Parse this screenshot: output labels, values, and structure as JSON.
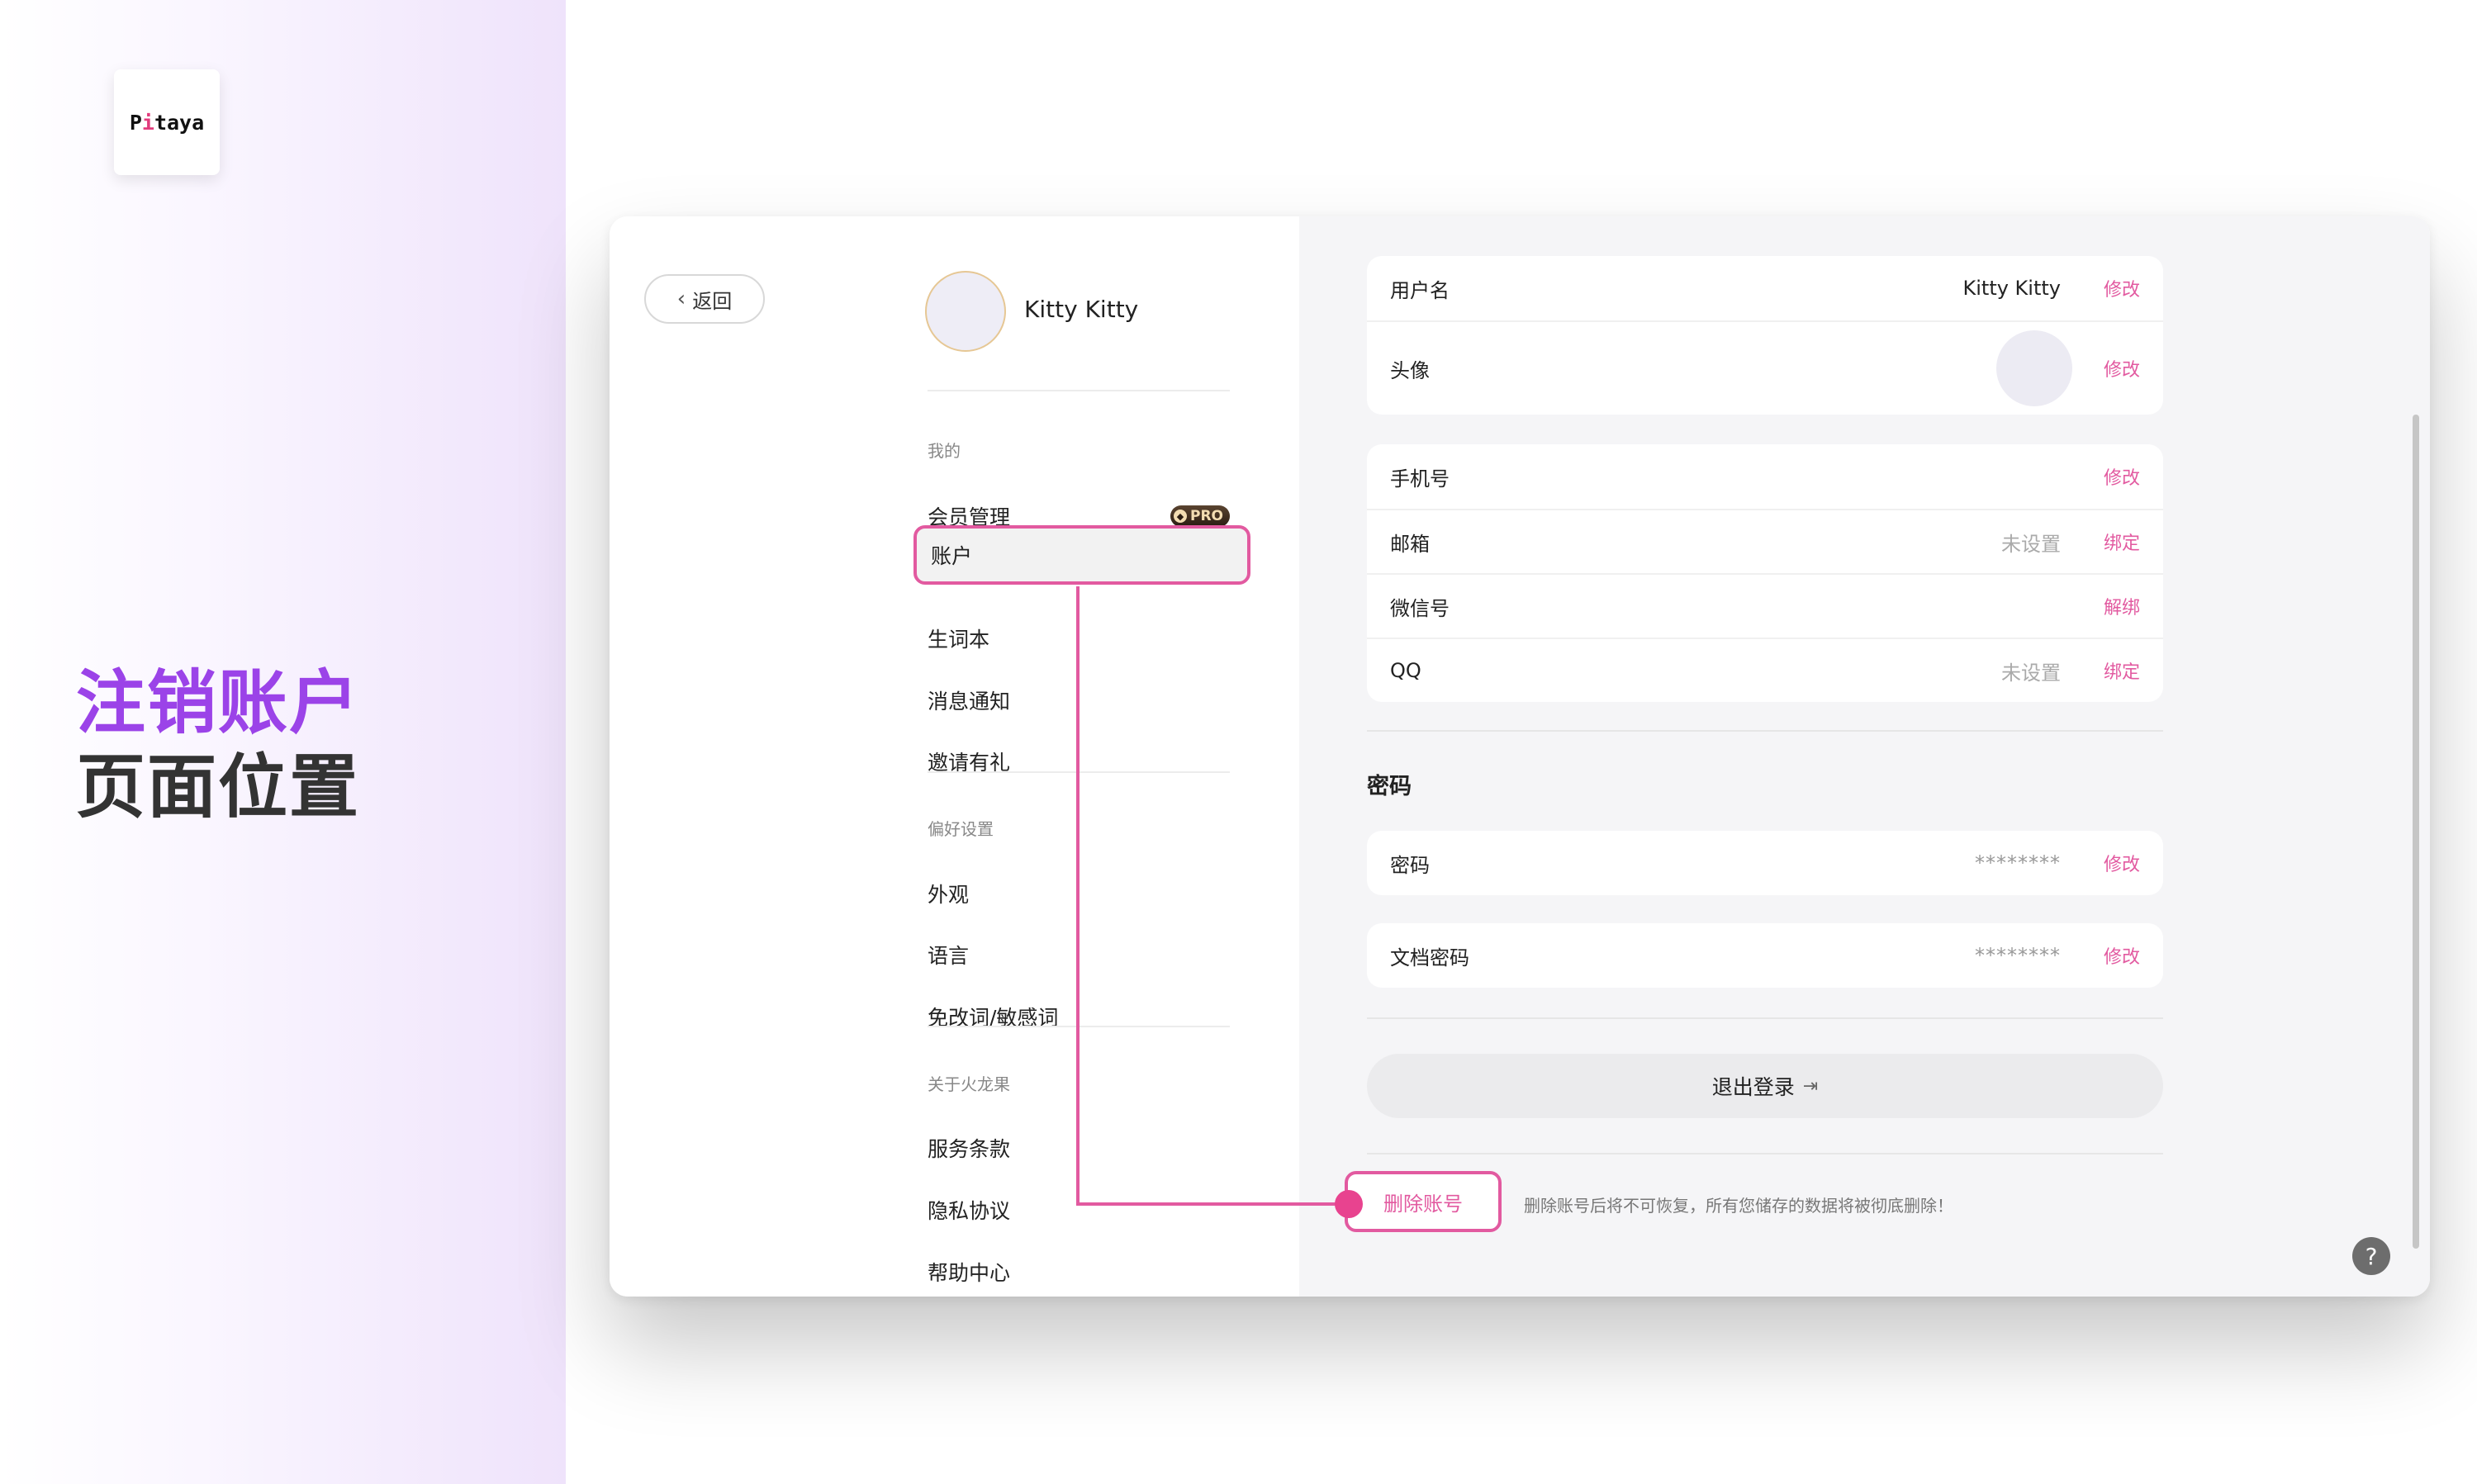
{
  "brand": {
    "logo_text_pre": "P",
    "logo_text_i": "i",
    "logo_text_post": "taya"
  },
  "headline": {
    "line1": "注销账户",
    "line2": "页面位置"
  },
  "sidebar": {
    "back_label": "返回",
    "user_name": "Kitty Kitty",
    "section_mine": "我的",
    "items_mine": [
      {
        "label": "会员管理",
        "badge": "PRO"
      },
      {
        "label": "账户"
      },
      {
        "label": "生词本"
      },
      {
        "label": "消息通知"
      },
      {
        "label": "邀请有礼"
      }
    ],
    "section_pref": "偏好设置",
    "items_pref": [
      {
        "label": "外观"
      },
      {
        "label": "语言"
      },
      {
        "label": "免改词/敏感词"
      }
    ],
    "section_about": "关于火龙果",
    "items_about": [
      {
        "label": "服务条款"
      },
      {
        "label": "隐私协议"
      },
      {
        "label": "帮助中心"
      }
    ]
  },
  "account": {
    "profile_rows": [
      {
        "label": "用户名",
        "value": "Kitty Kitty",
        "action": "修改"
      },
      {
        "label": "头像",
        "action": "修改"
      }
    ],
    "contact_rows": [
      {
        "label": "手机号",
        "value": "",
        "action": "修改"
      },
      {
        "label": "邮箱",
        "value": "未设置",
        "action": "绑定"
      },
      {
        "label": "微信号",
        "value": "",
        "action": "解绑"
      },
      {
        "label": "QQ",
        "value": "未设置",
        "action": "绑定"
      }
    ],
    "password_title": "密码",
    "password_rows": [
      {
        "label": "密码",
        "value": "********",
        "action": "修改"
      },
      {
        "label": "文档密码",
        "value": "********",
        "action": "修改"
      }
    ],
    "logout_label": "退出登录",
    "delete_label": "删除账号",
    "delete_note": "删除账号后将不可恢复，所有您储存的数据将被彻底删除！",
    "help_label": "?"
  },
  "colors": {
    "accent": "#e25aa0",
    "headline_purple": "#9b43e8"
  },
  "icons": {
    "back": "chevron-left-icon",
    "logout": "logout-icon",
    "help": "question-icon",
    "pro": "gem-icon"
  }
}
